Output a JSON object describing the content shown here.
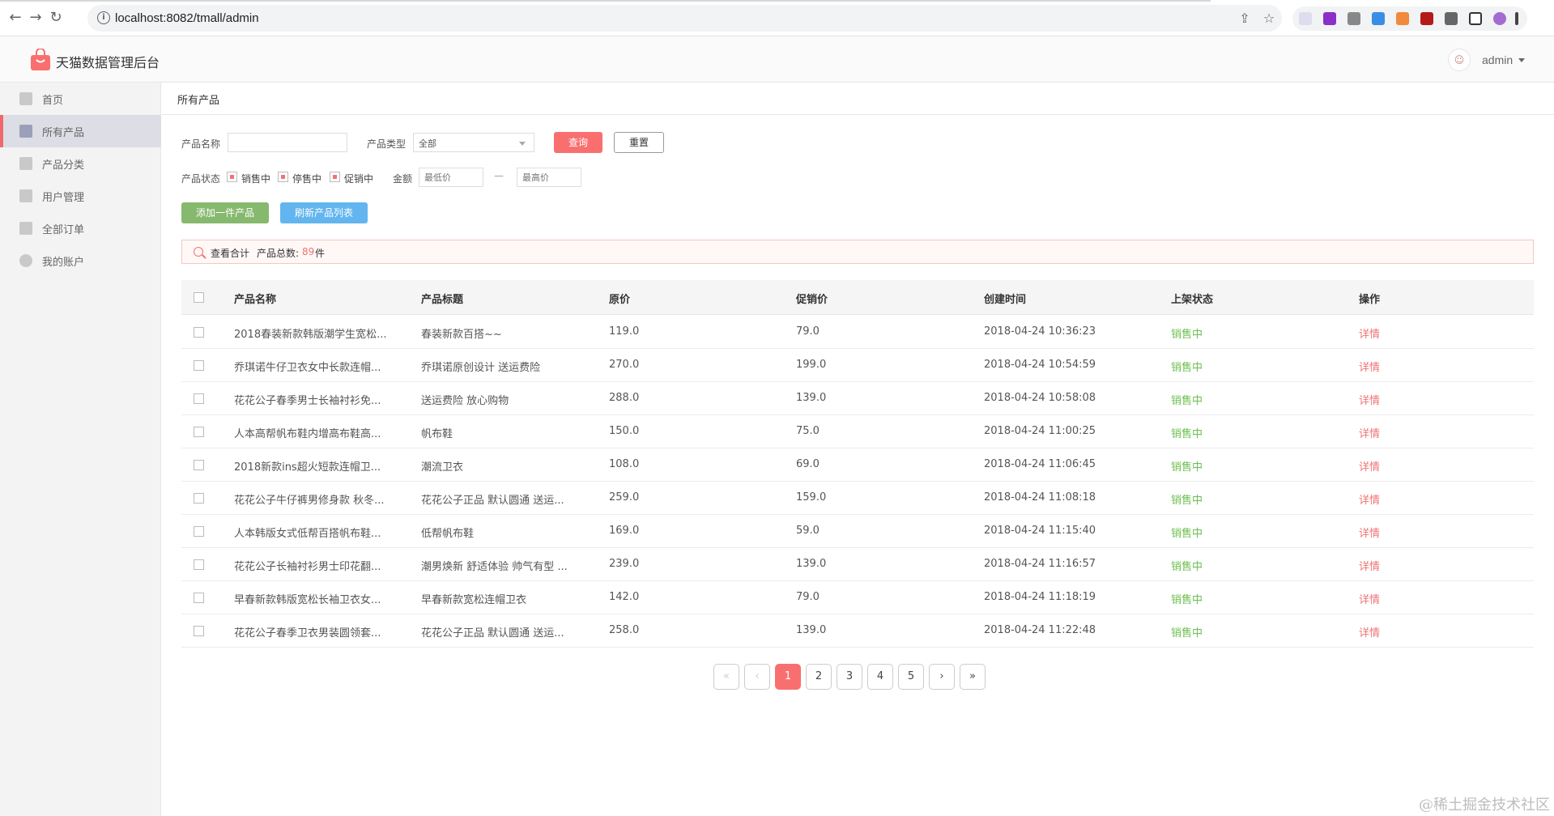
{
  "browser": {
    "url": "localhost:8082/tmall/admin",
    "back": "←",
    "forward": "→",
    "reload": "↻",
    "info": "i"
  },
  "header": {
    "title": "天猫数据管理后台",
    "user": "admin",
    "brand_color": "#f96f6f"
  },
  "sidebar": {
    "items": [
      {
        "label": "首页",
        "icon": "home-icon"
      },
      {
        "label": "所有产品",
        "icon": "product-icon"
      },
      {
        "label": "产品分类",
        "icon": "category-icon"
      },
      {
        "label": "用户管理",
        "icon": "user-icon"
      },
      {
        "label": "全部订单",
        "icon": "order-icon"
      },
      {
        "label": "我的账户",
        "icon": "gear-icon"
      }
    ]
  },
  "main": {
    "breadcrumb": "所有产品",
    "filters": {
      "name_label": "产品名称",
      "name_value": "",
      "type_label": "产品类型",
      "type_value": "全部",
      "query_label": "查询",
      "reset_label": "重置",
      "status_label": "产品状态",
      "status_options": [
        "销售中",
        "停售中",
        "促销中"
      ],
      "amount_label": "金额",
      "min_placeholder": "最低价",
      "max_placeholder": "最高价",
      "dash": "—"
    },
    "actions": {
      "add_label": "添加一件产品",
      "refresh_label": "刷新产品列表"
    },
    "summary": {
      "view": "查看合计",
      "total_label": "产品总数:",
      "total_count": "89",
      "unit": "件"
    },
    "table": {
      "headers": [
        "产品名称",
        "产品标题",
        "原价",
        "促销价",
        "创建时间",
        "上架状态",
        "操作"
      ],
      "rows": [
        {
          "name": "2018春装新款韩版潮学生宽松...",
          "title": "春装新款百搭~~",
          "price": "119.0",
          "promo": "79.0",
          "created": "2018-04-24 10:36:23",
          "status": "销售中",
          "op": "详情"
        },
        {
          "name": "乔琪诺牛仔卫衣女中长款连帽...",
          "title": "乔琪诺原创设计 送运费险",
          "price": "270.0",
          "promo": "199.0",
          "created": "2018-04-24 10:54:59",
          "status": "销售中",
          "op": "详情"
        },
        {
          "name": "花花公子春季男士长袖衬衫免...",
          "title": "送运费险 放心购物",
          "price": "288.0",
          "promo": "139.0",
          "created": "2018-04-24 10:58:08",
          "status": "销售中",
          "op": "详情"
        },
        {
          "name": "人本高帮帆布鞋内增高布鞋高...",
          "title": "帆布鞋",
          "price": "150.0",
          "promo": "75.0",
          "created": "2018-04-24 11:00:25",
          "status": "销售中",
          "op": "详情"
        },
        {
          "name": "2018新款ins超火短款连帽卫...",
          "title": "潮流卫衣",
          "price": "108.0",
          "promo": "69.0",
          "created": "2018-04-24 11:06:45",
          "status": "销售中",
          "op": "详情"
        },
        {
          "name": "花花公子牛仔裤男修身款 秋冬...",
          "title": "花花公子正品 默认圆通 送运...",
          "price": "259.0",
          "promo": "159.0",
          "created": "2018-04-24 11:08:18",
          "status": "销售中",
          "op": "详情"
        },
        {
          "name": "人本韩版女式低帮百搭帆布鞋...",
          "title": "低帮帆布鞋",
          "price": "169.0",
          "promo": "59.0",
          "created": "2018-04-24 11:15:40",
          "status": "销售中",
          "op": "详情"
        },
        {
          "name": "花花公子长袖衬衫男士印花翻...",
          "title": "潮男焕新 舒适体验 帅气有型 ...",
          "price": "239.0",
          "promo": "139.0",
          "created": "2018-04-24 11:16:57",
          "status": "销售中",
          "op": "详情"
        },
        {
          "name": "早春新款韩版宽松长袖卫衣女...",
          "title": "早春新款宽松连帽卫衣",
          "price": "142.0",
          "promo": "79.0",
          "created": "2018-04-24 11:18:19",
          "status": "销售中",
          "op": "详情"
        },
        {
          "name": "花花公子春季卫衣男装圆领套...",
          "title": "花花公子正品 默认圆通 送运...",
          "price": "258.0",
          "promo": "139.0",
          "created": "2018-04-24 11:22:48",
          "status": "销售中",
          "op": "详情"
        }
      ]
    },
    "pagination": {
      "first": "«",
      "prev": "‹",
      "pages": [
        "1",
        "2",
        "3",
        "4",
        "5"
      ],
      "current": "1",
      "next": "›",
      "last": "»"
    }
  },
  "watermark": "@稀土掘金技术社区"
}
